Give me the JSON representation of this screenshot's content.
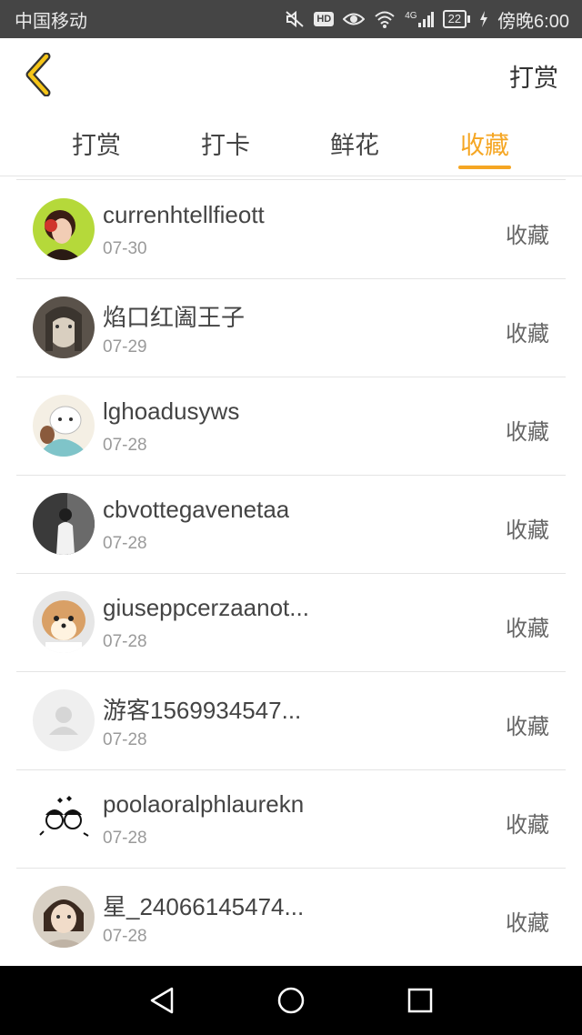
{
  "status_bar": {
    "carrier": "中国移动",
    "network": "4G",
    "battery": "22",
    "time": "傍晚6:00"
  },
  "header": {
    "action_label": "打赏"
  },
  "tabs": [
    {
      "label": "打赏",
      "active": false
    },
    {
      "label": "打卡",
      "active": false
    },
    {
      "label": "鲜花",
      "active": false
    },
    {
      "label": "收藏",
      "active": true
    }
  ],
  "colors": {
    "accent": "#f5a623",
    "status_bar_bg": "#454545",
    "nav_bar_bg": "#000000"
  },
  "list": [
    {
      "name": "currenhtellfieott",
      "date": "07-30",
      "action": "收藏"
    },
    {
      "name": "焰口红阖王子",
      "date": "07-29",
      "action": "收藏"
    },
    {
      "name": "lghoadusyws",
      "date": "07-28",
      "action": "收藏"
    },
    {
      "name": "cbvottegavenetaa",
      "date": "07-28",
      "action": "收藏"
    },
    {
      "name": "giuseppcerzaanot...",
      "date": "07-28",
      "action": "收藏"
    },
    {
      "name": "游客1569934547...",
      "date": "07-28",
      "action": "收藏"
    },
    {
      "name": "poolaoralphlaurekn",
      "date": "07-28",
      "action": "收藏"
    },
    {
      "name": "星_24066145474...",
      "date": "07-28",
      "action": "收藏"
    }
  ]
}
